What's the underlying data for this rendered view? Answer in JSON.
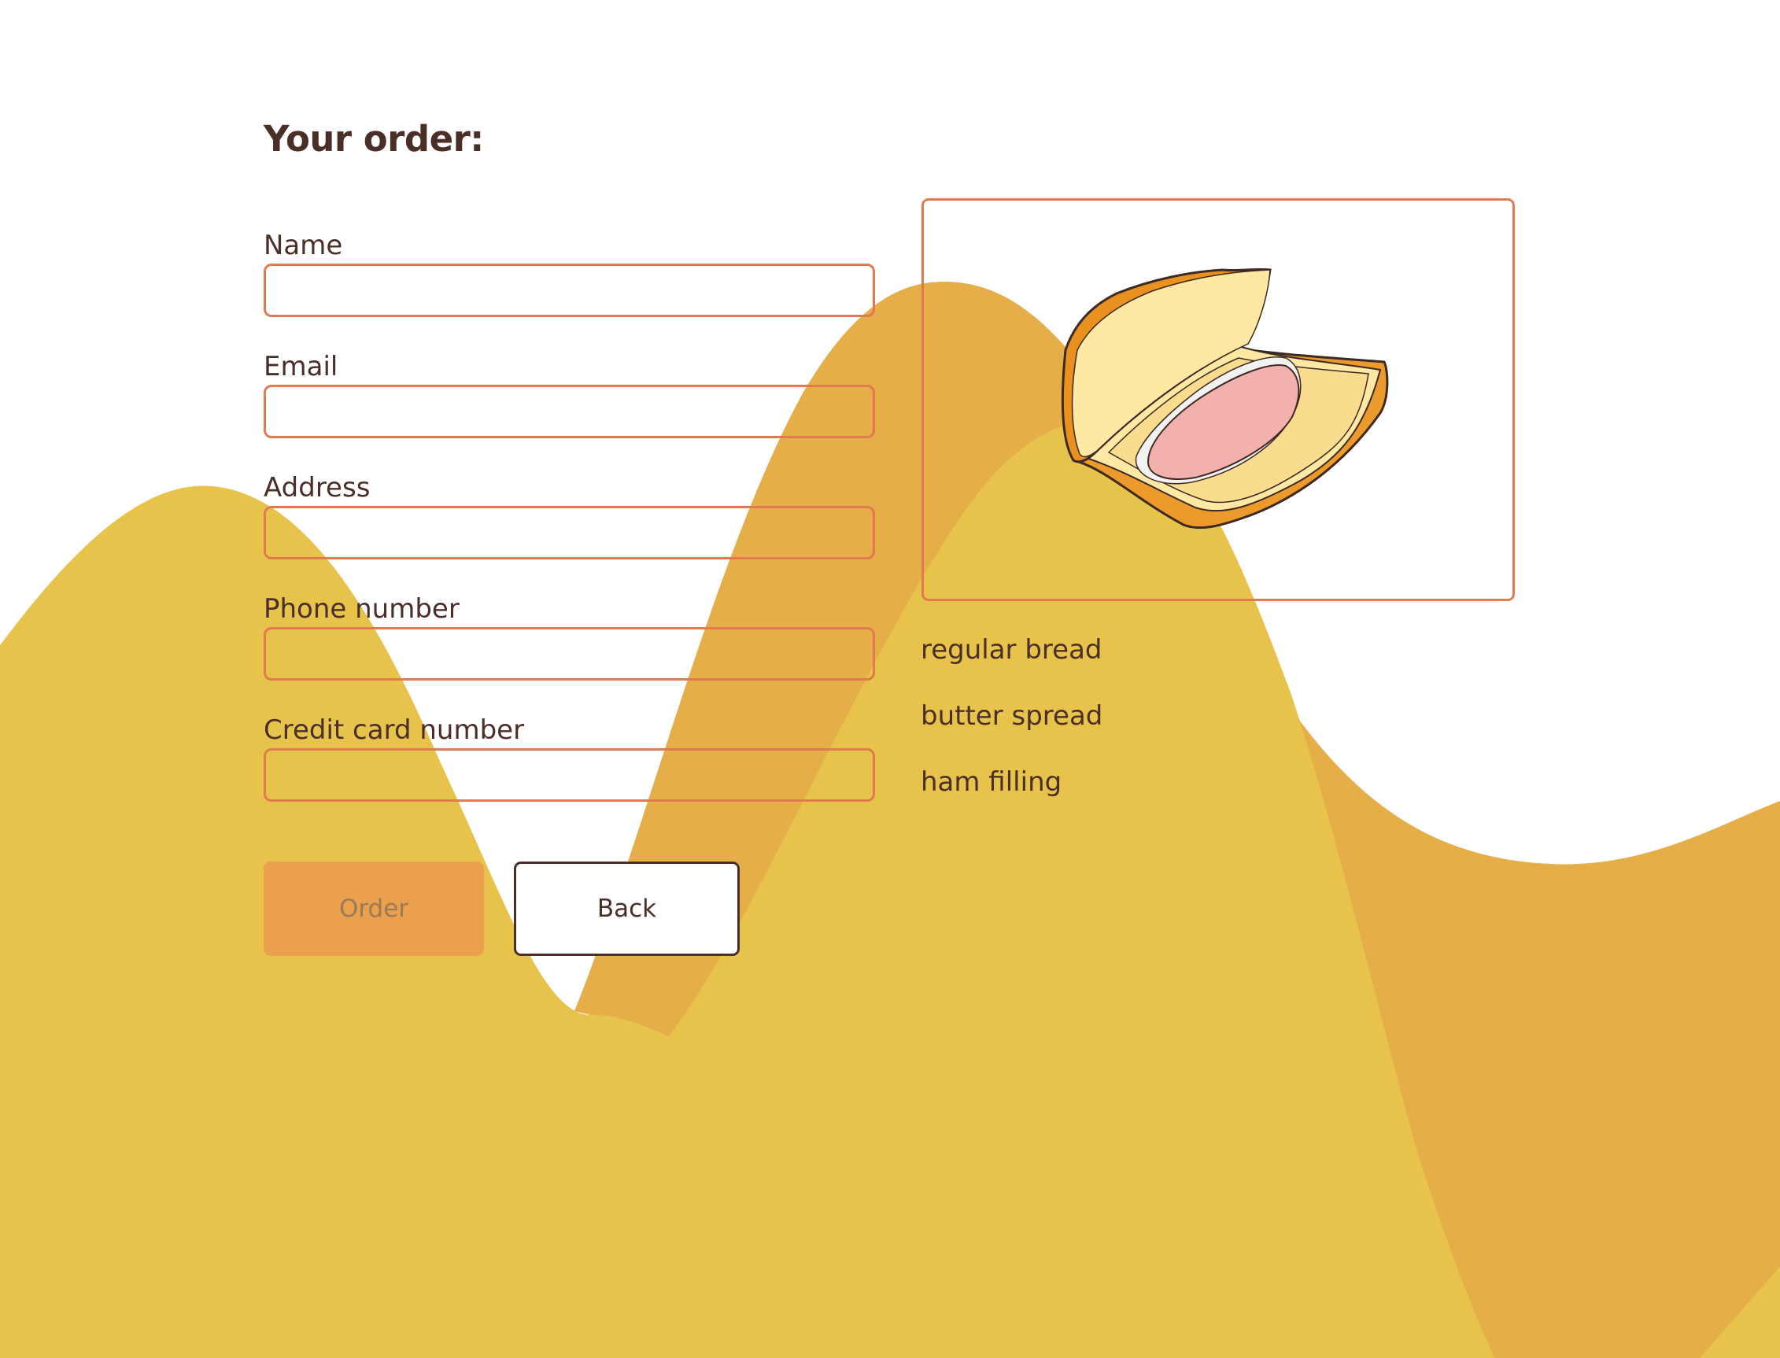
{
  "page": {
    "title": "Your order:"
  },
  "form": {
    "fields": [
      {
        "label": "Name",
        "value": "",
        "placeholder": ""
      },
      {
        "label": "Email",
        "value": "",
        "placeholder": ""
      },
      {
        "label": "Address",
        "value": "",
        "placeholder": ""
      },
      {
        "label": "Phone number",
        "value": "",
        "placeholder": ""
      },
      {
        "label": "Credit card number",
        "value": "",
        "placeholder": ""
      }
    ],
    "order_label": "Order",
    "back_label": "Back"
  },
  "sandwich": {
    "ingredients": [
      "regular bread",
      "butter spread",
      "ham filling"
    ]
  },
  "colors": {
    "accent_border": "#e27a50",
    "order_button": "#eba04e",
    "text": "#4a2e28",
    "wave_light": "#e8c34c",
    "wave_dark": "#e5ae49"
  }
}
